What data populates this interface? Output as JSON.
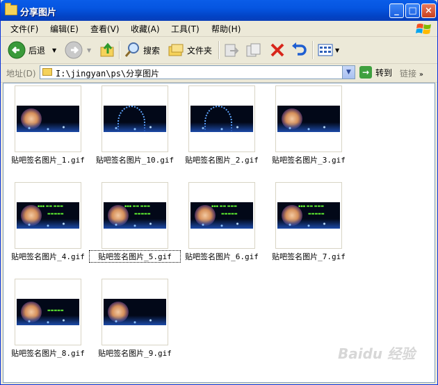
{
  "window": {
    "title": "分享图片"
  },
  "title_buttons": {
    "minimize": "_",
    "maximize": "□",
    "close": "×"
  },
  "menu": [
    "文件(F)",
    "编辑(E)",
    "查看(V)",
    "收藏(A)",
    "工具(T)",
    "帮助(H)"
  ],
  "toolbar": {
    "back_label": "后退",
    "search_label": "搜索",
    "folders_label": "文件夹"
  },
  "address": {
    "label": "地址(D)",
    "path": "I:\\jingyan\\ps\\分享图片",
    "go_label": "转到",
    "links_label": "链接"
  },
  "files": [
    {
      "name": "贴吧签名图片_1.gif",
      "variant": "face"
    },
    {
      "name": "贴吧签名图片_10.gif",
      "variant": "arc"
    },
    {
      "name": "贴吧签名图片_2.gif",
      "variant": "arc"
    },
    {
      "name": "贴吧签名图片_3.gif",
      "variant": "face"
    },
    {
      "name": "贴吧签名图片_4.gif",
      "variant": "text"
    },
    {
      "name": "贴吧签名图片_5.gif",
      "variant": "text",
      "selected": true
    },
    {
      "name": "贴吧签名图片_6.gif",
      "variant": "text"
    },
    {
      "name": "贴吧签名图片_7.gif",
      "variant": "text"
    },
    {
      "name": "贴吧签名图片_8.gif",
      "variant": "text2"
    },
    {
      "name": "贴吧签名图片_9.gif",
      "variant": "face"
    }
  ],
  "watermark": "Baidu 经验"
}
